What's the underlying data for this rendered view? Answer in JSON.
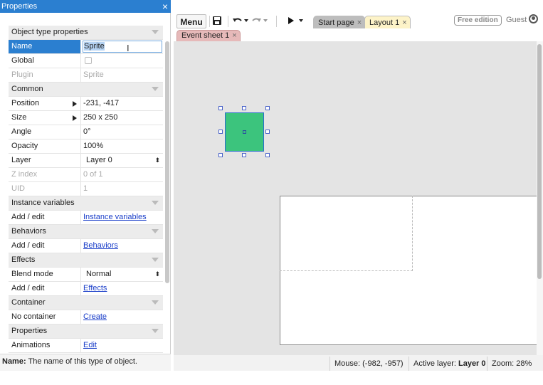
{
  "properties_panel": {
    "title": "Properties",
    "close_glyph": "×",
    "rows": [
      {
        "type": "category",
        "label": "Object type properties"
      },
      {
        "type": "selected",
        "label": "Name",
        "value": "Sprite"
      },
      {
        "type": "checkbox",
        "label": "Global",
        "value": ""
      },
      {
        "type": "disabled",
        "label": "Plugin",
        "value": "Sprite"
      },
      {
        "type": "category",
        "label": "Common"
      },
      {
        "type": "expand",
        "label": "Position",
        "value": "-231, -417"
      },
      {
        "type": "expand",
        "label": "Size",
        "value": "250 x 250"
      },
      {
        "type": "text",
        "label": "Angle",
        "value": "0°"
      },
      {
        "type": "text",
        "label": "Opacity",
        "value": "100%"
      },
      {
        "type": "select",
        "label": "Layer",
        "value": "Layer 0"
      },
      {
        "type": "disabled",
        "label": "Z index",
        "value": "0 of 1"
      },
      {
        "type": "disabled",
        "label": "UID",
        "value": "1"
      },
      {
        "type": "category",
        "label": "Instance variables"
      },
      {
        "type": "link",
        "label": "Add / edit",
        "value": "Instance variables"
      },
      {
        "type": "category",
        "label": "Behaviors"
      },
      {
        "type": "link",
        "label": "Add / edit",
        "value": "Behaviors"
      },
      {
        "type": "category",
        "label": "Effects"
      },
      {
        "type": "select",
        "label": "Blend mode",
        "value": "Normal"
      },
      {
        "type": "link",
        "label": "Add / edit",
        "value": "Effects"
      },
      {
        "type": "category",
        "label": "Container"
      },
      {
        "type": "link",
        "label": "No container",
        "value": "Create"
      },
      {
        "type": "category",
        "label": "Properties"
      },
      {
        "type": "link",
        "label": "Animations",
        "value": "Edit"
      }
    ],
    "description_label": "Name:",
    "description_text": " The name of this type of object."
  },
  "toolbar": {
    "menu_label": "Menu",
    "tabs": [
      {
        "label": "Start page",
        "close": "×"
      },
      {
        "label": "Layout 1",
        "close": "×"
      }
    ],
    "edition_badge": "Free edition",
    "user_label": "Guest"
  },
  "sub_tabs": [
    {
      "label": "Event sheet 1",
      "close": "×"
    }
  ],
  "status_bar": {
    "mouse": "Mouse: (-982, -957)",
    "active_layer_label": "Active layer:",
    "active_layer_value": "Layer 0",
    "zoom": "Zoom: 28%"
  },
  "colors": {
    "accent": "#2b7fd0",
    "sprite_fill": "#3cc47d",
    "layout_tab": "#fdf3c8",
    "event_tab": "#e6b9b9"
  }
}
